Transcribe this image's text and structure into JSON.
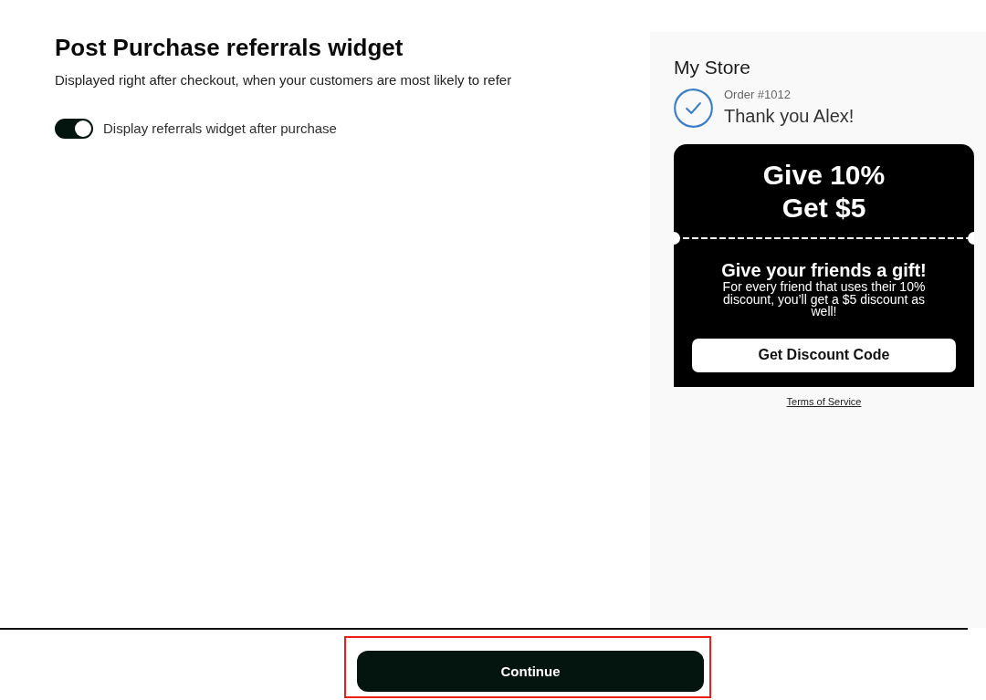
{
  "settings": {
    "title": "Post Purchase referrals widget",
    "description": "Displayed right after checkout, when your customers are most likely to refer",
    "toggle": {
      "label": "Display referrals widget after purchase",
      "on": true
    }
  },
  "preview": {
    "store_name": "My Store",
    "order_number": "Order #1012",
    "thank_you": "Thank you Alex!",
    "offer_card": {
      "headline": [
        "Give 10%",
        "Get $5"
      ],
      "subtitle": "Give your friends a gift!",
      "body": "For every friend that uses their 10% discount, you’ll get a $5 discount as well!",
      "button": "Get Discount Code"
    },
    "terms_link": "Terms of Service"
  },
  "footer": {
    "continue_button": {
      "label": "Continue",
      "highlighted": true
    }
  }
}
